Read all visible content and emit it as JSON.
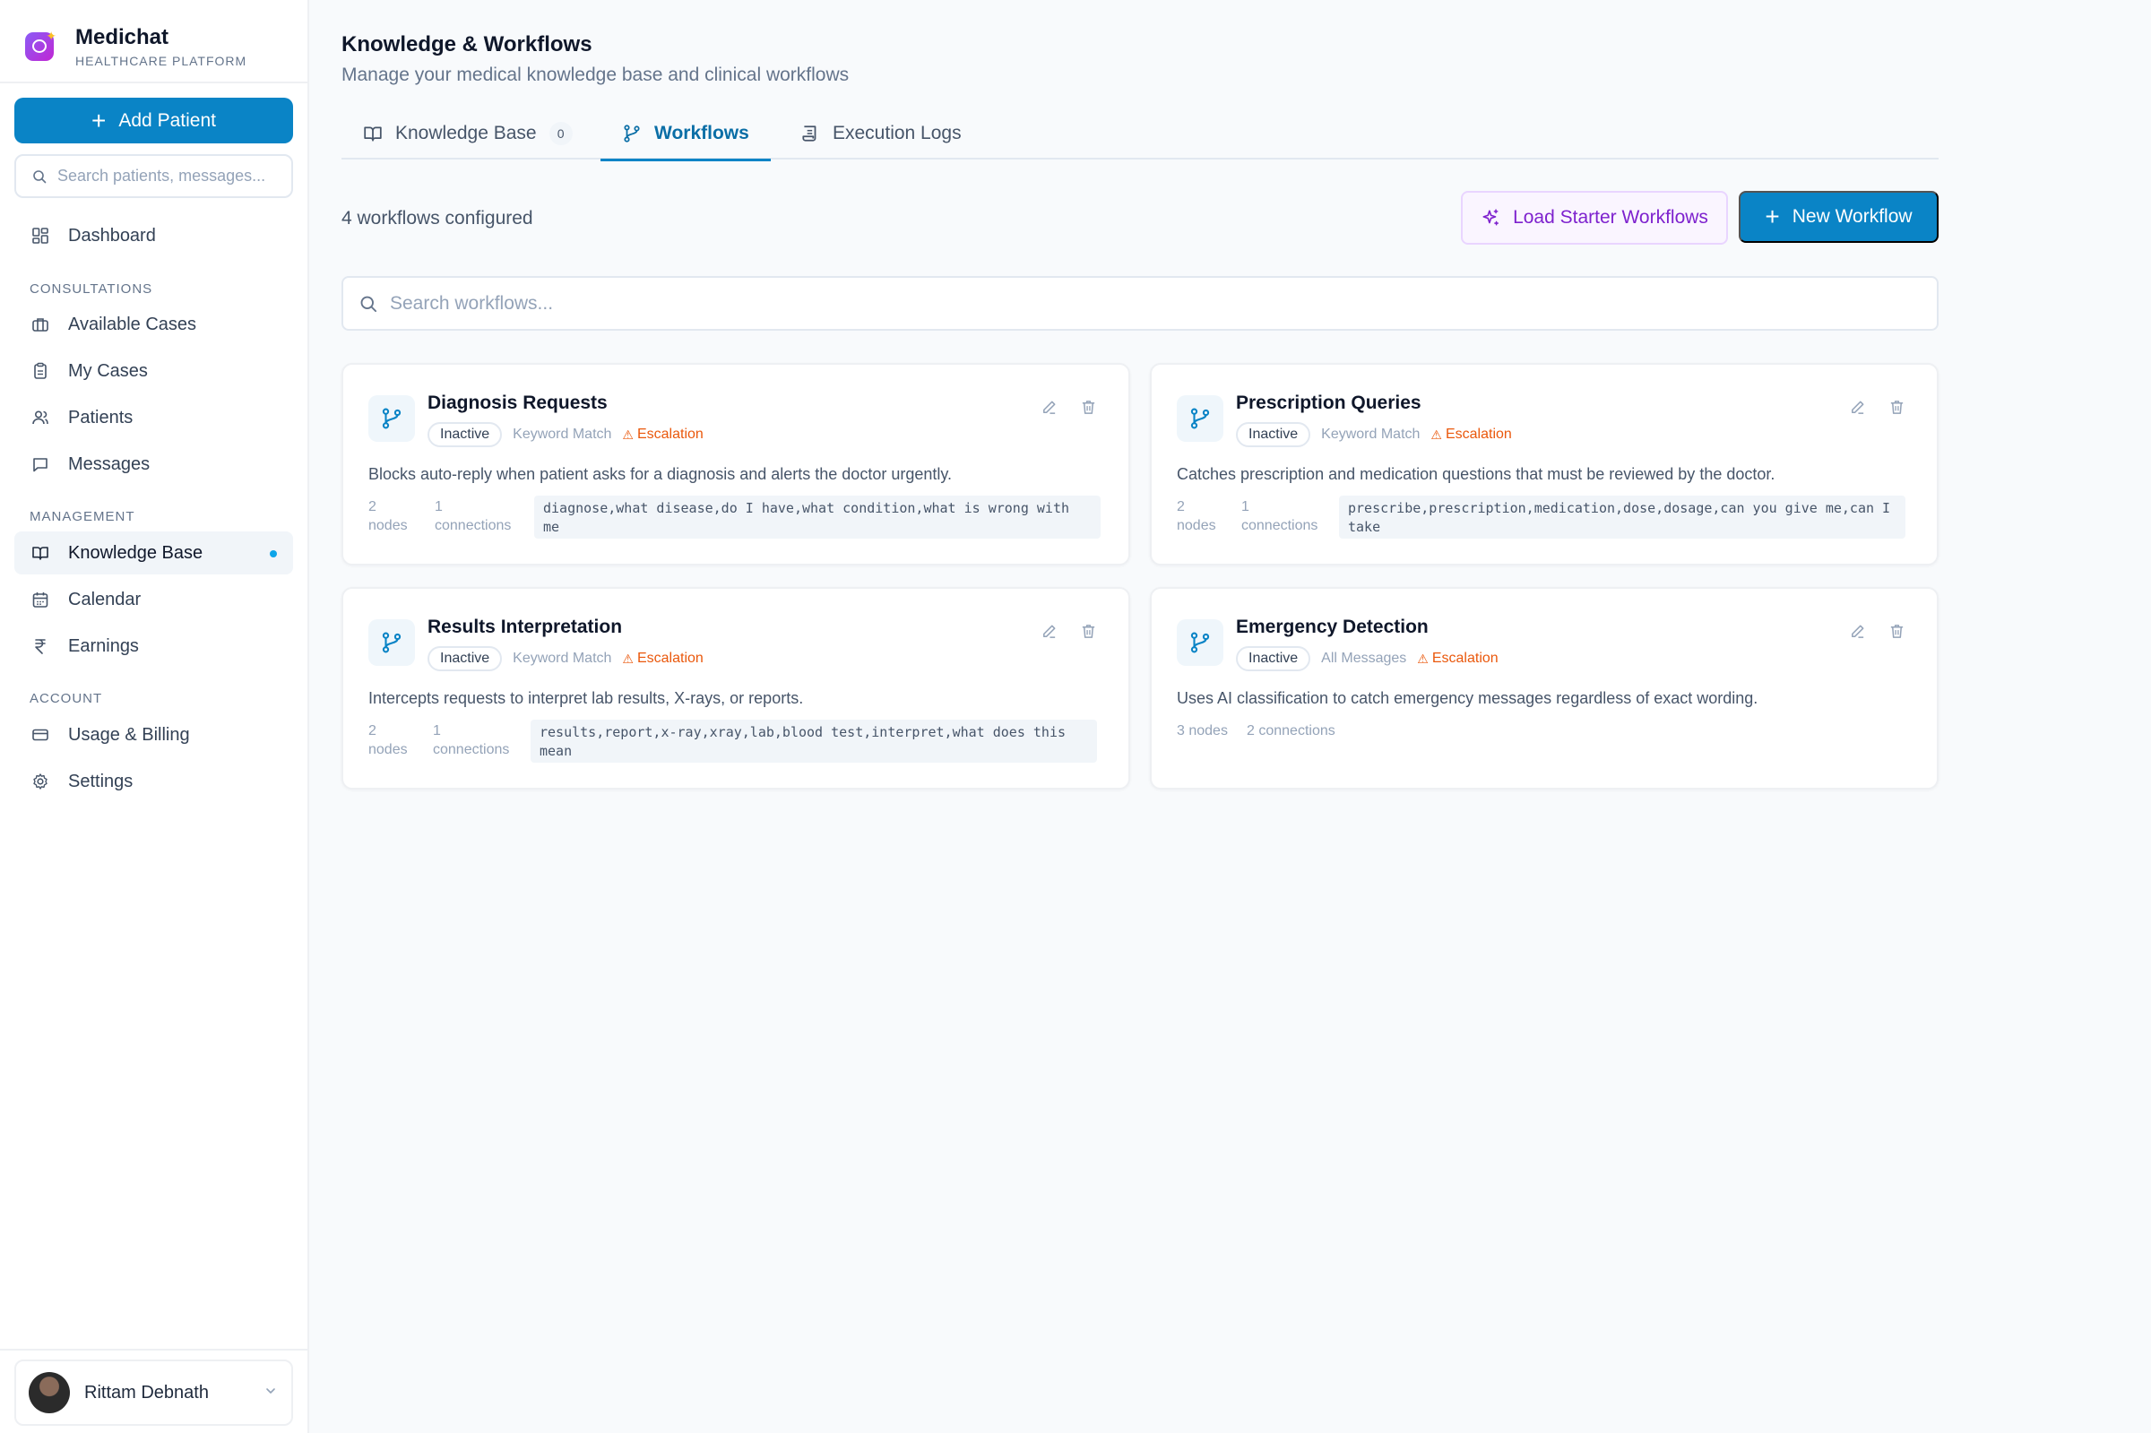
{
  "brand": {
    "name": "Medichat",
    "subtitle": "HEALTHCARE PLATFORM"
  },
  "sidebar": {
    "add_patient": "Add Patient",
    "search_placeholder": "Search patients, messages...",
    "dashboard": "Dashboard",
    "sections": {
      "consultations": "CONSULTATIONS",
      "management": "MANAGEMENT",
      "account": "ACCOUNT"
    },
    "consultations": [
      "Available Cases",
      "My Cases",
      "Patients",
      "Messages"
    ],
    "management": [
      "Knowledge Base",
      "Calendar",
      "Earnings"
    ],
    "account": [
      "Usage & Billing",
      "Settings"
    ],
    "active_item": "Knowledge Base",
    "user": {
      "name": "Rittam Debnath"
    }
  },
  "header": {
    "title": "Knowledge & Workflows",
    "subtitle": "Manage your medical knowledge base and clinical workflows"
  },
  "tabs": [
    {
      "label": "Knowledge Base",
      "count": "0"
    },
    {
      "label": "Workflows"
    },
    {
      "label": "Execution Logs"
    }
  ],
  "toolbar": {
    "count_text": "4 workflows configured",
    "load_starter": "Load Starter Workflows",
    "new_workflow": "New Workflow",
    "search_placeholder": "Search workflows..."
  },
  "workflows": [
    {
      "title": "Diagnosis Requests",
      "status": "Inactive",
      "trigger": "Keyword Match",
      "action": "Escalation",
      "description": "Blocks auto-reply when patient asks for a diagnosis and alerts the doctor urgently.",
      "nodes_num": "2",
      "nodes_label": "nodes",
      "conn_num": "1",
      "conn_label": "connections",
      "keywords": "diagnose,what disease,do I have,what condition,what is wrong with me"
    },
    {
      "title": "Prescription Queries",
      "status": "Inactive",
      "trigger": "Keyword Match",
      "action": "Escalation",
      "description": "Catches prescription and medication questions that must be reviewed by the doctor.",
      "nodes_num": "2",
      "nodes_label": "nodes",
      "conn_num": "1",
      "conn_label": "connections",
      "keywords": "prescribe,prescription,medication,dose,dosage,can you give me,can I take"
    },
    {
      "title": "Results Interpretation",
      "status": "Inactive",
      "trigger": "Keyword Match",
      "action": "Escalation",
      "description": "Intercepts requests to interpret lab results, X-rays, or reports.",
      "nodes_num": "2",
      "nodes_label": "nodes",
      "conn_num": "1",
      "conn_label": "connections",
      "keywords": "results,report,x-ray,xray,lab,blood test,interpret,what does this mean"
    },
    {
      "title": "Emergency Detection",
      "status": "Inactive",
      "trigger": "All Messages",
      "action": "Escalation",
      "description": "Uses AI classification to catch emergency messages regardless of exact wording.",
      "nodes_text": "3 nodes",
      "conn_text": "2 connections"
    }
  ],
  "colors": {
    "primary": "#0a84c6",
    "escalation": "#ea580c",
    "starter_purple": "#7e22ce"
  }
}
